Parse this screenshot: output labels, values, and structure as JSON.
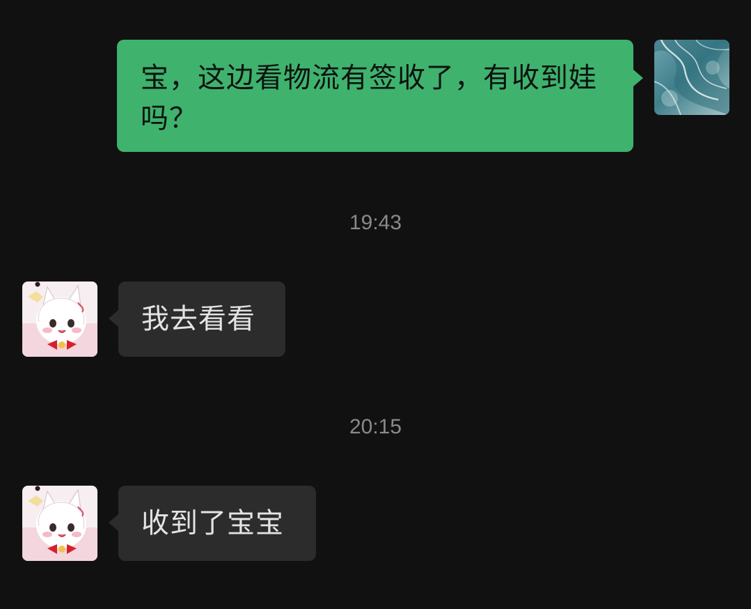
{
  "messages": [
    {
      "side": "right",
      "text": "宝，这边看物流有签收了，有收到娃吗？"
    },
    {
      "side": "left",
      "text": "我去看看"
    },
    {
      "side": "left",
      "text": "收到了宝宝"
    }
  ],
  "timestamps": [
    "19:43",
    "20:15"
  ],
  "colors": {
    "background": "#111111",
    "outgoing_bubble": "#3fb26e",
    "incoming_bubble": "#2c2c2c",
    "timestamp": "#8a8a8a"
  },
  "avatars": {
    "self": "teal-marble-avatar",
    "contact": "anime-cat-girl-avatar"
  }
}
